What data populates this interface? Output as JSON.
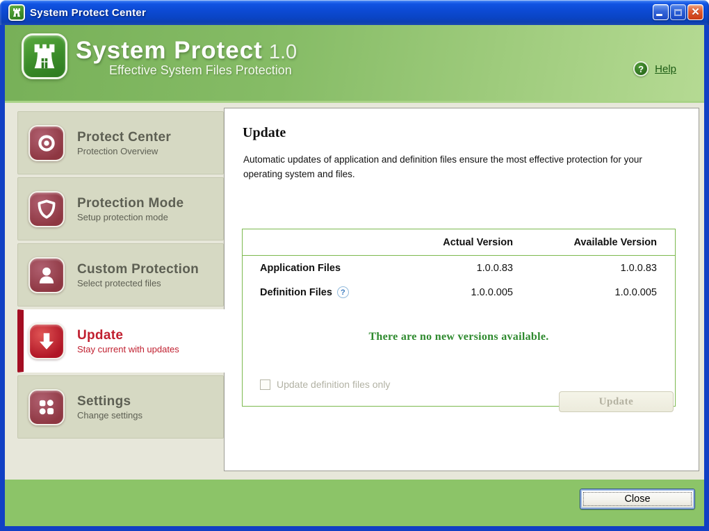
{
  "window": {
    "title": "System Protect Center"
  },
  "icons": {
    "help_glyph": "?",
    "close_glyph": "✕"
  },
  "header": {
    "app_name": "System Protect",
    "version": "1.0",
    "tagline": "Effective System Files Protection",
    "help_label": "Help"
  },
  "sidebar": {
    "items": [
      {
        "title": "Protect Center",
        "subtitle": "Protection Overview",
        "icon": "target-icon",
        "selected": false
      },
      {
        "title": "Protection Mode",
        "subtitle": "Setup protection mode",
        "icon": "shield-icon",
        "selected": false
      },
      {
        "title": "Custom Protection",
        "subtitle": "Select protected files",
        "icon": "user-icon",
        "selected": false
      },
      {
        "title": "Update",
        "subtitle": "Stay current with updates",
        "icon": "download-arrow-icon",
        "selected": true
      },
      {
        "title": "Settings",
        "subtitle": "Change settings",
        "icon": "puzzle-icon",
        "selected": false
      }
    ]
  },
  "main": {
    "heading": "Update",
    "description": "Automatic updates of application and definition files ensure the most effective protection for your operating system and files.",
    "table": {
      "columns": [
        "",
        "Actual Version",
        "Available Version"
      ],
      "rows": [
        {
          "label": "Application Files",
          "actual": "1.0.0.83",
          "available": "1.0.0.83"
        },
        {
          "label": "Definition Files",
          "actual": "1.0.0.005",
          "available": "1.0.0.005"
        }
      ],
      "status_message": "There are no new versions available."
    },
    "checkbox_label": "Update definition files only",
    "checkbox_checked": false,
    "update_button_label": "Update",
    "update_button_enabled": false
  },
  "footer": {
    "close_button_label": "Close"
  },
  "colors": {
    "titlebar_blue": "#0c4ad4",
    "frame_blue": "#1140c4",
    "header_green": "#86bc66",
    "footer_green": "#8cc468",
    "table_border_green": "#7cb94e",
    "status_green": "#2e8a2e",
    "selected_red": "#c01f2f",
    "selected_bar_red": "#a30d22",
    "sidebar_bg": "#d6d9c3",
    "content_bg": "#e7e7da"
  }
}
